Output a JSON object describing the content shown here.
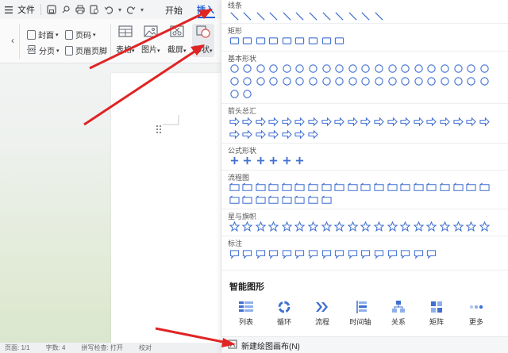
{
  "menubar": {
    "menu_icon": "hamburger-icon",
    "file_label": "文件",
    "tab_start": "开始",
    "tab_insert": "插入"
  },
  "ribbon": {
    "cover_label": "封面",
    "page_number_label": "页码",
    "page_break_label": "分页",
    "header_footer_label": "页眉页脚",
    "table_label": "表格",
    "picture_label": "图片",
    "screenshot_label": "截屏",
    "shapes_label": "形状"
  },
  "status": {
    "page": "页面: 1/1",
    "words": "字数: 4",
    "spell": "拼写检查: 打开",
    "proofread": "校对"
  },
  "panel": {
    "sections": [
      {
        "title": "线条",
        "count": 12
      },
      {
        "title": "矩形",
        "count": 9
      },
      {
        "title": "基本形状",
        "count": 42
      },
      {
        "title": "箭头总汇",
        "count": 27
      },
      {
        "title": "公式形状",
        "count": 6
      },
      {
        "title": "流程图",
        "count": 28
      },
      {
        "title": "星与旗帜",
        "count": 20
      },
      {
        "title": "标注",
        "count": 16
      }
    ],
    "smart_title": "智能图形",
    "smart_items": [
      "列表",
      "循环",
      "流程",
      "时间轴",
      "关系",
      "矩阵",
      "更多"
    ],
    "new_canvas_label": "新建绘图画布(N)",
    "shape_color": "#3f6fd0"
  },
  "colors": {
    "accent": "#1f5fd6",
    "arrow": "#e02424"
  }
}
